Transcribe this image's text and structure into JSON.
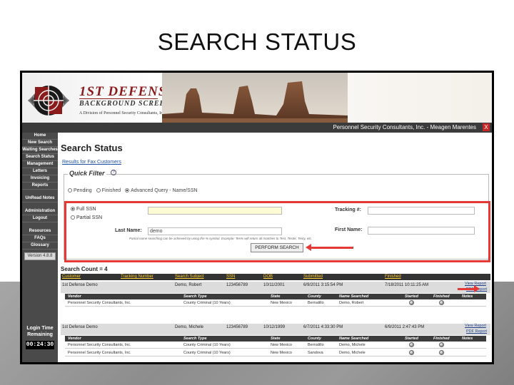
{
  "slide": {
    "title": "SEARCH STATUS"
  },
  "header": {
    "brand_name": "1ST DEFENSE",
    "brand_sub": "BACKGROUND SCREENING",
    "brand_division": "A Division of Personnel Security Consultants, Inc.",
    "user_text": "Personnel Security Consultants, Inc. - Meagen Marentes",
    "close_label": "X"
  },
  "sidebar": {
    "items": [
      "Home",
      "New Search",
      "Waiting Searches",
      "Search Status",
      "Management",
      "Letters",
      "Invoicing",
      "Reports",
      "UnRead Notes",
      "Administration",
      "Logout",
      "Resources",
      "FAQs",
      "Glossary"
    ],
    "version": "Version 4.8.8",
    "login_time_label": "Login Time Remaining",
    "timer": "00:24:30"
  },
  "main": {
    "title": "Search Status",
    "sub_link": "Results for Fax Customers",
    "quick_filter": {
      "legend": "Quick Filter",
      "help": "?",
      "options": [
        "Pending",
        "Finished",
        "Advanced Query - Name/SSN"
      ],
      "selected": "Advanced Query - Name/SSN"
    },
    "form": {
      "ssn_options": [
        "Full SSN",
        "Partial SSN"
      ],
      "tracking_label": "Tracking #:",
      "last_name_label": "Last Name:",
      "last_name_value": "demo",
      "first_name_label": "First Name:",
      "hint": "Partial name searching can be achieved by using the % symbol. Example: Tes% will return all matches to Test, Tester, Testy, etc.",
      "button": "PERFORM SEARCH"
    },
    "count": "Search Count = 4",
    "columns": [
      "Customer",
      "Tracking Number",
      "Search Subject",
      "SSN",
      "DOB",
      "Submitted",
      "Finished"
    ],
    "records": [
      {
        "customer": "1st Defense Demo",
        "subject": "Demo, Robert",
        "ssn": "123456789",
        "dob": "10/11/2001",
        "submitted": "6/9/2011 3:15:54 PM",
        "finished": "7/18/2011 10:11:25 AM",
        "links": [
          "View Report",
          "PDF Report"
        ],
        "sub_columns": [
          "Vendor",
          "Search Type",
          "State",
          "County",
          "Name Searched",
          "Started",
          "Finished",
          "Notes"
        ],
        "rows": [
          {
            "vendor": "Personnel Security Consultants, Inc.",
            "type": "County Criminal (10 Years)",
            "state": "New Mexico",
            "county": "Bernalillo",
            "name": "Demo, Robert"
          }
        ]
      },
      {
        "customer": "1st Defense Demo",
        "subject": "Demo, Michele",
        "ssn": "123456789",
        "dob": "10/12/1999",
        "submitted": "6/7/2011 4:33:30 PM",
        "finished": "6/9/2011 2:47:43 PM",
        "links": [
          "View Report",
          "PDF Report"
        ],
        "sub_columns": [
          "Vendor",
          "Search Type",
          "State",
          "County",
          "Name Searched",
          "Started",
          "Finished",
          "Notes"
        ],
        "rows": [
          {
            "vendor": "Personnel Security Consultants, Inc.",
            "type": "County Criminal (10 Years)",
            "state": "New Mexico",
            "county": "Bernalillo",
            "name": "Demo, Michele"
          },
          {
            "vendor": "Personnel Security Consultants, Inc.",
            "type": "County Criminal (10 Years)",
            "state": "New Mexico",
            "county": "Sandova",
            "name": "Demo, Michele"
          }
        ]
      }
    ]
  },
  "colors": {
    "accent_red": "#e53935",
    "brand": "#8b1a1a",
    "nav": "#4a4a4a"
  }
}
